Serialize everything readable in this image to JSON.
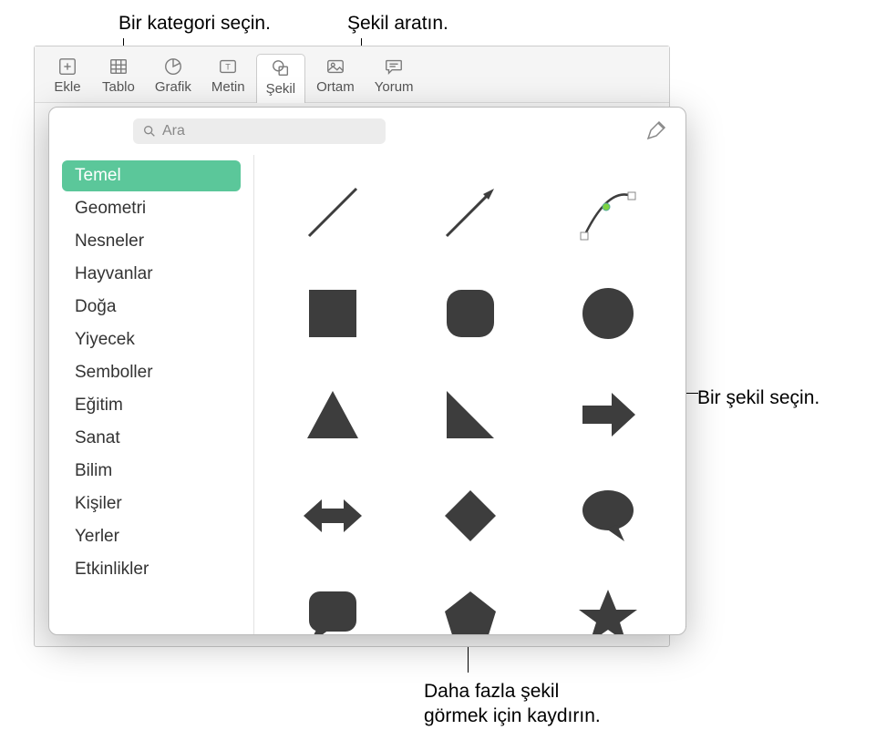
{
  "callouts": {
    "category": "Bir kategori seçin.",
    "search": "Şekil aratın.",
    "select_shape": "Bir şekil seçin.",
    "scroll_more": "Daha fazla şekil\ngörmek için kaydırın."
  },
  "toolbar": {
    "items": [
      {
        "label": "Ekle",
        "icon": "plus-box"
      },
      {
        "label": "Tablo",
        "icon": "table"
      },
      {
        "label": "Grafik",
        "icon": "pie"
      },
      {
        "label": "Metin",
        "icon": "text-box"
      },
      {
        "label": "Şekil",
        "icon": "shapes",
        "active": true
      },
      {
        "label": "Ortam",
        "icon": "photo"
      },
      {
        "label": "Yorum",
        "icon": "comment"
      }
    ]
  },
  "search": {
    "placeholder": "Ara"
  },
  "sidebar": {
    "items": [
      {
        "label": "Temel",
        "selected": true
      },
      {
        "label": "Geometri"
      },
      {
        "label": "Nesneler"
      },
      {
        "label": "Hayvanlar"
      },
      {
        "label": "Doğa"
      },
      {
        "label": "Yiyecek"
      },
      {
        "label": "Semboller"
      },
      {
        "label": "Eğitim"
      },
      {
        "label": "Sanat"
      },
      {
        "label": "Bilim"
      },
      {
        "label": "Kişiler"
      },
      {
        "label": "Yerler"
      },
      {
        "label": "Etkinlikler"
      }
    ]
  },
  "shapes": [
    {
      "name": "line"
    },
    {
      "name": "arrow-line"
    },
    {
      "name": "curve"
    },
    {
      "name": "square"
    },
    {
      "name": "rounded-square"
    },
    {
      "name": "circle"
    },
    {
      "name": "triangle"
    },
    {
      "name": "right-triangle"
    },
    {
      "name": "arrow-right"
    },
    {
      "name": "arrow-bidir"
    },
    {
      "name": "diamond"
    },
    {
      "name": "speech-bubble"
    },
    {
      "name": "quote-bubble"
    },
    {
      "name": "pentagon"
    },
    {
      "name": "star"
    }
  ],
  "colors": {
    "shape_fill": "#3d3d3d",
    "accent": "#5bc79a",
    "curve_handle": "#7dd441"
  }
}
